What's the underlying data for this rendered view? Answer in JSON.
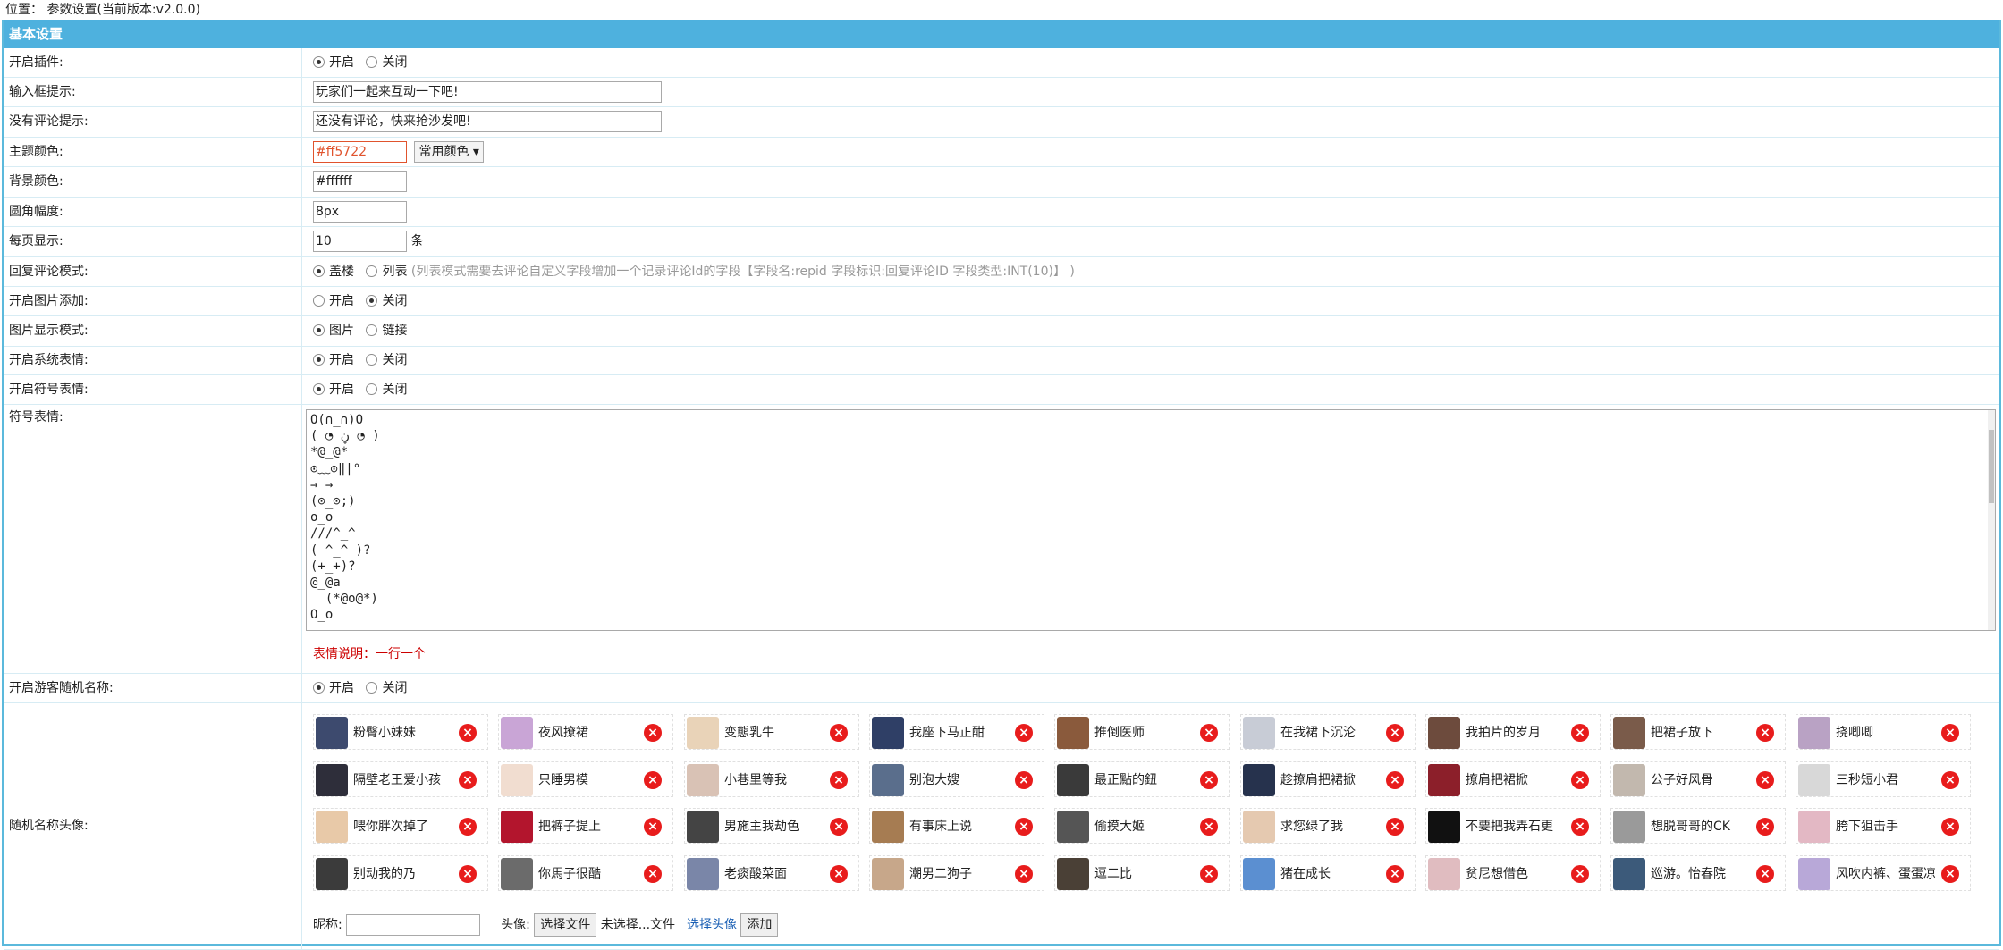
{
  "location": {
    "label": "位置：",
    "value": "参数设置(当前版本:v2.0.0)"
  },
  "panel_title": "基本设置",
  "fields": {
    "plugin_enable": {
      "label": "开启插件:",
      "options": [
        "开启",
        "关闭"
      ],
      "selected": "开启"
    },
    "input_hint": {
      "label": "输入框提示:",
      "value": "玩家们一起来互动一下吧!"
    },
    "no_comment_hint": {
      "label": "没有评论提示:",
      "value": "还没有评论，快来抢沙发吧!"
    },
    "theme_color": {
      "label": "主题颜色:",
      "value": "#ff5722",
      "select_label": "常用颜色",
      "color": "#e0532d"
    },
    "bg_color": {
      "label": "背景颜色:",
      "value": "#ffffff"
    },
    "radius": {
      "label": "圆角幅度:",
      "value": "8px"
    },
    "per_page": {
      "label": "每页显示:",
      "value": "10",
      "unit": "条"
    },
    "reply_mode": {
      "label": "回复评论模式:",
      "options": [
        "盖楼",
        "列表"
      ],
      "selected": "盖楼",
      "hint": "(列表模式需要去评论自定义字段增加一个记录评论Id的字段【字段名:repid 字段标识:回复评论ID 字段类型:INT(10)】 )"
    },
    "image_add": {
      "label": "开启图片添加:",
      "options": [
        "开启",
        "关闭"
      ],
      "selected": "关闭"
    },
    "image_mode": {
      "label": "图片显示模式:",
      "options": [
        "图片",
        "链接"
      ],
      "selected": "图片"
    },
    "sys_emoji": {
      "label": "开启系统表情:",
      "options": [
        "开启",
        "关闭"
      ],
      "selected": "开启"
    },
    "sym_emoji": {
      "label": "开启符号表情:",
      "options": [
        "开启",
        "关闭"
      ],
      "selected": "开启"
    },
    "emoji_list": {
      "label": "符号表情:",
      "lines": [
        "O(∩_∩)O",
        "( ◔ ڼ ◔ )",
        "*@_@*",
        "⊙﹏⊙‖|°",
        "→_→",
        "(⊙_⊙;)",
        "o_o",
        "///^_^",
        "( ^_^ )?",
        "(+_+)?",
        "@_@a",
        "  (*@o@*)",
        "O_o"
      ],
      "note": "表情说明：一行一个"
    },
    "guest_random": {
      "label": "开启游客随机名称:",
      "options": [
        "开启",
        "关闭"
      ],
      "selected": "开启"
    },
    "avatars": {
      "label": "随机名称头像:",
      "items": [
        {
          "name": "粉臀小妹妹",
          "color": "#3d4a6e"
        },
        {
          "name": "夜风撩裙",
          "color": "#c9a5d6"
        },
        {
          "name": "变態乳牛",
          "color": "#e9d3b8"
        },
        {
          "name": "我座下马正酣",
          "color": "#2f3f66"
        },
        {
          "name": "推倒医师",
          "color": "#8a5a3c"
        },
        {
          "name": "在我裙下沉沦",
          "color": "#c8ccd6"
        },
        {
          "name": "我拍片的岁月",
          "color": "#6d4b3d"
        },
        {
          "name": "把裙子放下",
          "color": "#7a5b4a"
        },
        {
          "name": "挠唧唧",
          "color": "#b9a2c4"
        },
        {
          "name": "隔壁老王爱小孩",
          "color": "#2e2e3a"
        },
        {
          "name": "只睡男模",
          "color": "#f1ddd0"
        },
        {
          "name": "小巷里等我",
          "color": "#d9c2b5"
        },
        {
          "name": "别泡大嫂",
          "color": "#5a6e8c"
        },
        {
          "name": "最正點的鈕",
          "color": "#3a3a3a"
        },
        {
          "name": "趁撩肩把裙掀",
          "color": "#26324d"
        },
        {
          "name": "撩肩把裙掀",
          "color": "#8c1f2a"
        },
        {
          "name": "公子好风骨",
          "color": "#c2b8ae"
        },
        {
          "name": "三秒短小君",
          "color": "#d8d8d8"
        },
        {
          "name": "喂你胖次掉了",
          "color": "#e8c9a8"
        },
        {
          "name": "把裤子提上",
          "color": "#b3152d"
        },
        {
          "name": "男施主我劫色",
          "color": "#444444"
        },
        {
          "name": "有事床上说",
          "color": "#a67c52"
        },
        {
          "name": "偷摸大姬",
          "color": "#555555"
        },
        {
          "name": "求您绿了我",
          "color": "#e5c9b0"
        },
        {
          "name": "不要把我弄石更",
          "color": "#111111"
        },
        {
          "name": "想脱哥哥的CK",
          "color": "#9a9a9a"
        },
        {
          "name": "胯下狙击手",
          "color": "#e3b8c4"
        },
        {
          "name": "别动我的乃",
          "color": "#3b3b3b"
        },
        {
          "name": "你馬子很酷",
          "color": "#6b6b6b"
        },
        {
          "name": "老痰酸菜面",
          "color": "#7a86a8"
        },
        {
          "name": "潮男二狗子",
          "color": "#c7a78a"
        },
        {
          "name": "逗二比",
          "color": "#4a4036"
        },
        {
          "name": "猪在成长",
          "color": "#5b8fd1"
        },
        {
          "name": "贫尼想借色",
          "color": "#e0bcc0"
        },
        {
          "name": "巡游。怡春院",
          "color": "#3c5a7a"
        },
        {
          "name": "风吹内裤、蛋蛋凉",
          "color": "#b8a8d8"
        }
      ],
      "add": {
        "nick_label": "昵称:",
        "nick_value": "",
        "avatar_label": "头像:",
        "file_button": "选择文件",
        "file_status": "未选择...文件",
        "pick_link": "选择头像",
        "add_button": "添加"
      }
    }
  }
}
